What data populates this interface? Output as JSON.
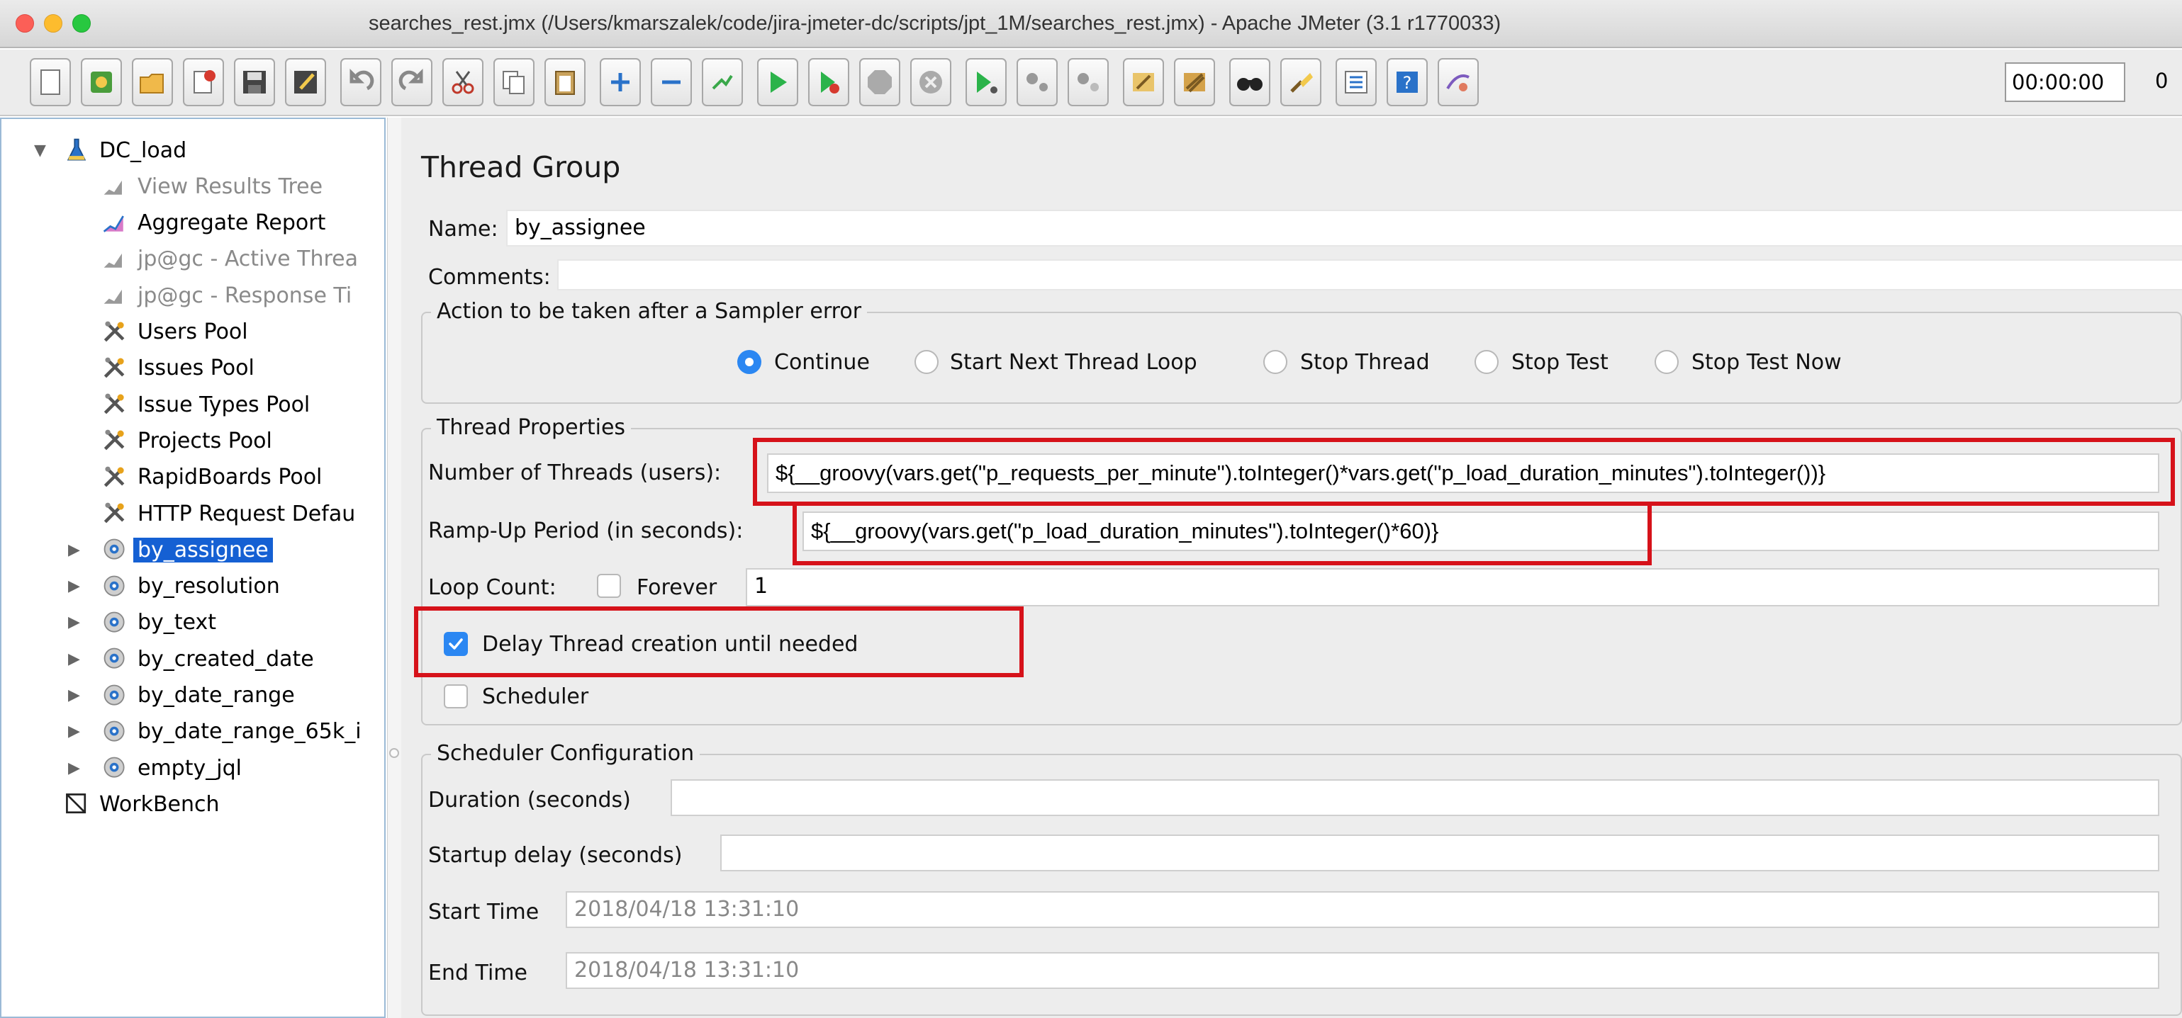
{
  "window": {
    "title": "searches_rest.jmx (/Users/kmarszalek/code/jira-jmeter-dc/scripts/jpt_1M/searches_rest.jmx) - Apache JMeter (3.1 r1770033)"
  },
  "toolbar": {
    "buttons": [
      "new-icon",
      "templates-icon",
      "open-icon",
      "close-icon",
      "save-icon",
      "save-as-icon",
      "undo-icon",
      "redo-icon",
      "cut-icon",
      "copy-icon",
      "paste-icon",
      "expand-icon",
      "collapse-icon",
      "toggle-icon",
      "start-icon",
      "start-no-pause-icon",
      "stop-icon",
      "shutdown-icon",
      "remote-start-icon",
      "remote-stop-icon",
      "remote-shutdown-icon",
      "clear-icon",
      "clear-all-icon",
      "search-icon",
      "reset-search-icon",
      "function-helper-icon",
      "help-icon",
      "ssl-manager-icon"
    ],
    "timer": "00:00:00",
    "error_count": "0"
  },
  "tree": {
    "items": [
      {
        "label": "DC_load",
        "level": 0,
        "icon": "test-plan-icon",
        "expanded": true
      },
      {
        "label": "View Results Tree",
        "level": 1,
        "icon": "listener-icon",
        "dim": true
      },
      {
        "label": "Aggregate Report",
        "level": 1,
        "icon": "report-icon"
      },
      {
        "label": "jp@gc - Active Threa",
        "level": 1,
        "icon": "listener-icon",
        "dim": true
      },
      {
        "label": "jp@gc - Response Ti",
        "level": 1,
        "icon": "listener-icon",
        "dim": true
      },
      {
        "label": "Users Pool",
        "level": 1,
        "icon": "config-icon"
      },
      {
        "label": "Issues Pool",
        "level": 1,
        "icon": "config-icon"
      },
      {
        "label": "Issue Types Pool",
        "level": 1,
        "icon": "config-icon"
      },
      {
        "label": "Projects Pool",
        "level": 1,
        "icon": "config-icon"
      },
      {
        "label": "RapidBoards Pool",
        "level": 1,
        "icon": "config-icon"
      },
      {
        "label": "HTTP Request Defau",
        "level": 1,
        "icon": "config-icon"
      },
      {
        "label": "by_assignee",
        "level": 1,
        "icon": "thread-group-icon",
        "collapsed": true,
        "selected": true
      },
      {
        "label": "by_resolution",
        "level": 1,
        "icon": "thread-group-icon",
        "collapsed": true
      },
      {
        "label": "by_text",
        "level": 1,
        "icon": "thread-group-icon",
        "collapsed": true
      },
      {
        "label": "by_created_date",
        "level": 1,
        "icon": "thread-group-icon",
        "collapsed": true
      },
      {
        "label": "by_date_range",
        "level": 1,
        "icon": "thread-group-icon",
        "collapsed": true
      },
      {
        "label": "by_date_range_65k_i",
        "level": 1,
        "icon": "thread-group-icon",
        "collapsed": true
      },
      {
        "label": "empty_jql",
        "level": 1,
        "icon": "thread-group-icon",
        "collapsed": true
      },
      {
        "label": "WorkBench",
        "level": 0,
        "icon": "workbench-icon"
      }
    ]
  },
  "panel": {
    "title": "Thread Group",
    "name_label": "Name:",
    "name_value": "by_assignee",
    "comments_label": "Comments:",
    "comments_value": "",
    "sampler_error": {
      "title": "Action to be taken after a Sampler error",
      "options": [
        "Continue",
        "Start Next Thread Loop",
        "Stop Thread",
        "Stop Test",
        "Stop Test Now"
      ],
      "selected": "Continue"
    },
    "thread_properties": {
      "title": "Thread Properties",
      "threads_label": "Number of Threads (users):",
      "threads_value": "${__groovy(vars.get(\"p_requests_per_minute\").toInteger()*vars.get(\"p_load_duration_minutes\").toInteger())}",
      "rampup_label": "Ramp-Up Period (in seconds):",
      "rampup_value": "${__groovy(vars.get(\"p_load_duration_minutes\").toInteger()*60)}",
      "loop_label": "Loop Count:",
      "forever_label": "Forever",
      "forever_checked": false,
      "loop_value": "1",
      "delay_label": "Delay Thread creation until needed",
      "delay_checked": true,
      "scheduler_label": "Scheduler",
      "scheduler_checked": false
    },
    "scheduler_config": {
      "title": "Scheduler Configuration",
      "duration_label": "Duration (seconds)",
      "duration_value": "",
      "startup_label": "Startup delay (seconds)",
      "startup_value": "",
      "start_label": "Start Time",
      "start_value": "2018/04/18 13:31:10",
      "end_label": "End Time",
      "end_value": "2018/04/18 13:31:10"
    }
  },
  "colors": {
    "highlight": "#d6121a",
    "selection": "#1560d3",
    "accent": "#2b87f2"
  }
}
